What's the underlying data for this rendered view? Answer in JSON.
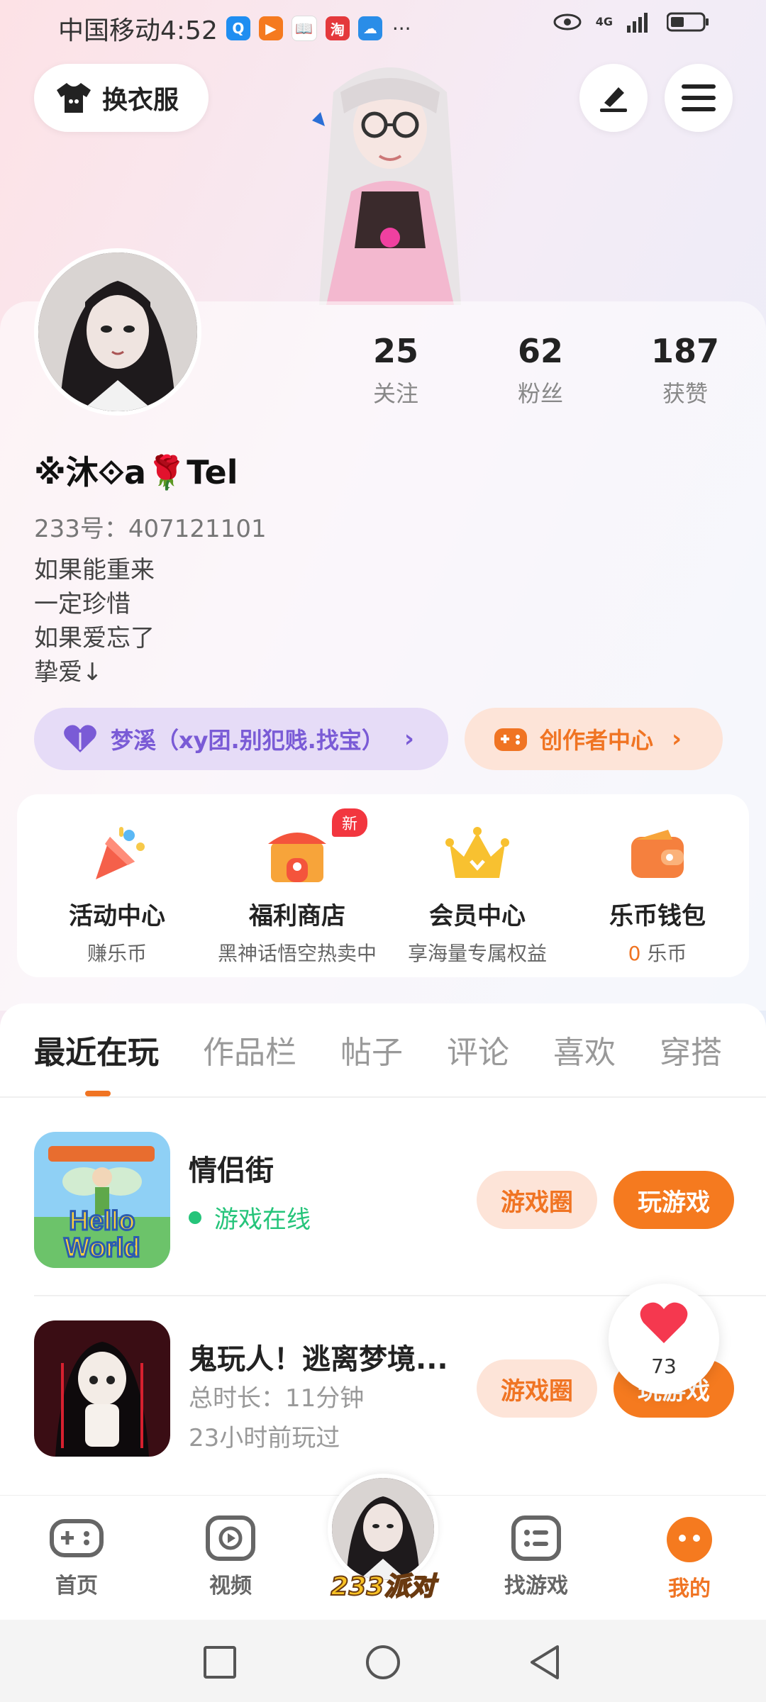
{
  "status_bar": {
    "carrier_time": "中国移动4:52",
    "more": "···",
    "network": "4G",
    "notification_apps": [
      "Q",
      "▶",
      "📖",
      "淘",
      "☁"
    ]
  },
  "header": {
    "outfit_label": "换衣服"
  },
  "profile": {
    "stats": [
      {
        "value": "25",
        "label": "关注"
      },
      {
        "value": "62",
        "label": "粉丝"
      },
      {
        "value": "187",
        "label": "获赞"
      }
    ],
    "nickname": "※沐⟐a🌹Tel",
    "uid": "233号：407121101",
    "bio": [
      "如果能重来",
      "一定珍惜",
      "如果爱忘了",
      "挚爱↓"
    ],
    "group_label": "梦溪（xy团.别犯贱.找宝）",
    "creator_label": "创作者中心"
  },
  "features": [
    {
      "title": "活动中心",
      "sub": "赚乐币",
      "icon": "party-popper-icon"
    },
    {
      "title": "福利商店",
      "sub": "黑神话悟空热卖中",
      "icon": "shop-icon",
      "badge": "新"
    },
    {
      "title": "会员中心",
      "sub": "享海量专属权益",
      "icon": "crown-icon"
    },
    {
      "title": "乐币钱包",
      "sub_value": "0",
      "sub_unit": " 乐币",
      "icon": "wallet-icon"
    }
  ],
  "tabs": [
    "最近在玩",
    "作品栏",
    "帖子",
    "评论",
    "喜欢",
    "穿搭"
  ],
  "games": [
    {
      "title": "情侣街",
      "status": "游戏在线",
      "icon_text_top": "Hello",
      "icon_text_bottom": "World",
      "circle_btn": "游戏圈",
      "play_btn": "玩游戏"
    },
    {
      "title": "鬼玩人！逃离梦境...",
      "duration": "总时长：11分钟",
      "last_played": "23小时前玩过",
      "circle_btn": "游戏圈",
      "play_btn": "玩游戏"
    }
  ],
  "heart": {
    "count": "73"
  },
  "nav": {
    "home": "首页",
    "video": "视频",
    "party": "233派对",
    "find": "找游戏",
    "me": "我的"
  },
  "colors": {
    "accent": "#f07423",
    "purple": "#7a5bd6",
    "online": "#25c47a"
  }
}
